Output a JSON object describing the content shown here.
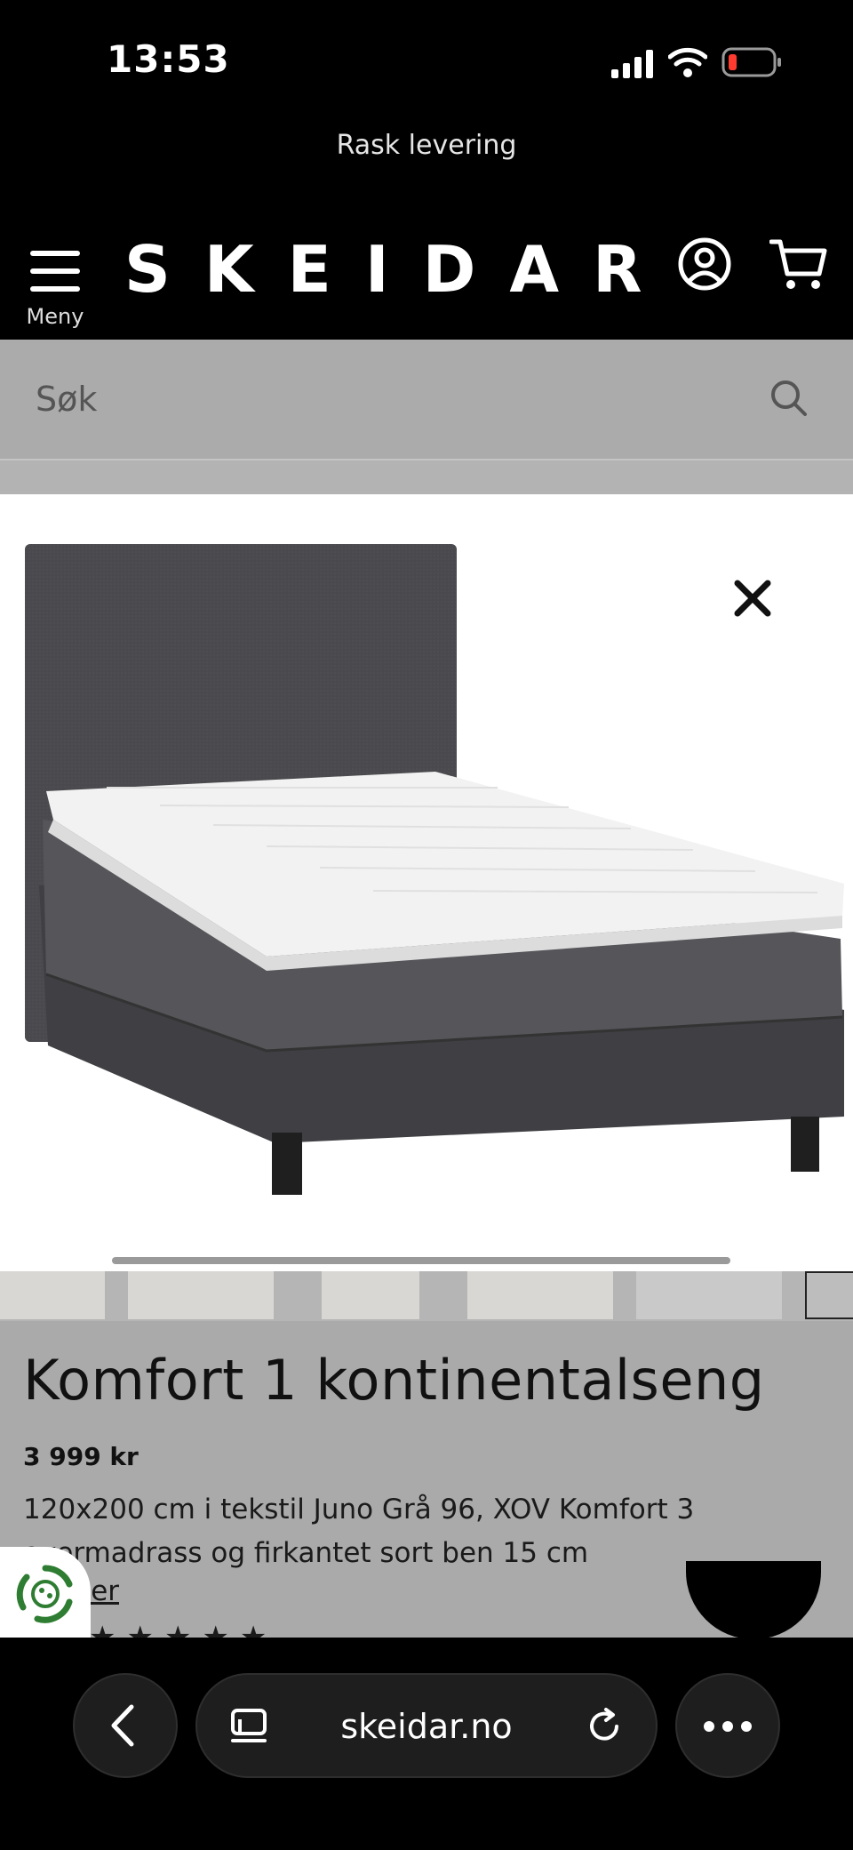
{
  "status_bar": {
    "time": "13:53"
  },
  "promo": {
    "text": "Rask levering"
  },
  "header": {
    "logo": "SKEIDAR",
    "menu_label": "Meny"
  },
  "search": {
    "placeholder": "Søk"
  },
  "product": {
    "title": "Komfort 1 kontinentalseng",
    "price": "3 999 kr",
    "description": "120x200 cm i tekstil Juno Grå 96, XOV Komfort 3 overmadrass og firkantet sort ben 15 cm",
    "read_more": "mer",
    "rating_stars": 5
  },
  "browser": {
    "url": "skeidar.no"
  },
  "colors": {
    "header_bg": "#000000",
    "search_bg": "#ababab",
    "bed_fabric": "#4a4a4e",
    "mattress": "#f2f2f2",
    "battery_low": "#ff3b30",
    "cookie_green": "#2e7d32"
  }
}
